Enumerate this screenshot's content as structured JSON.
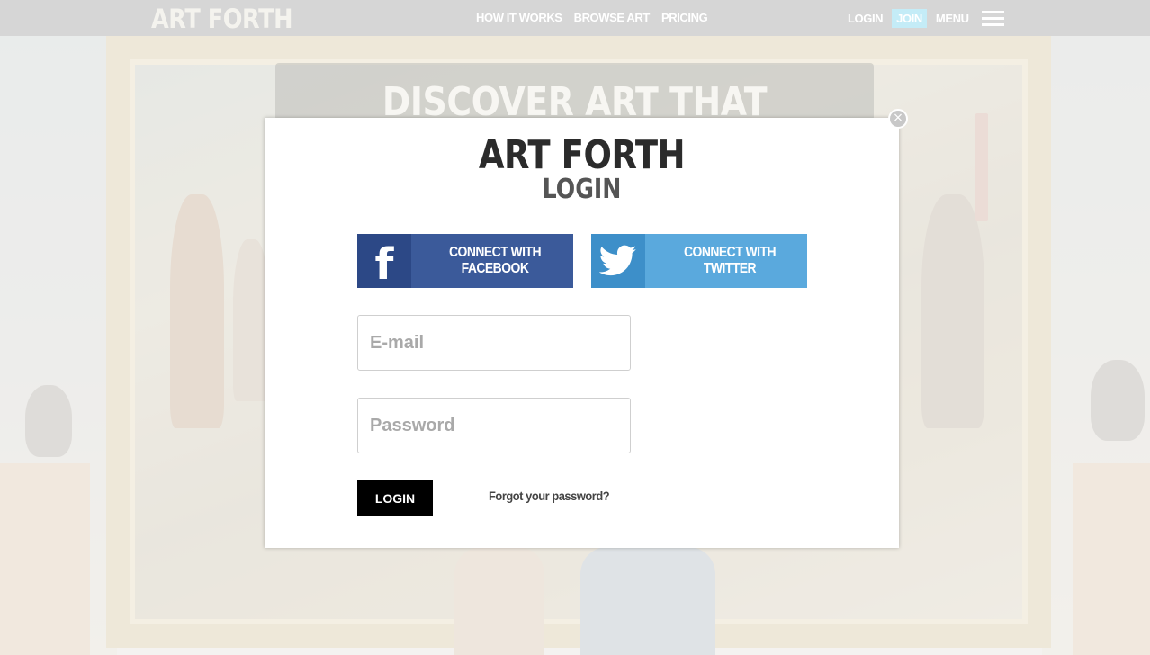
{
  "nav": {
    "logo": "ART FORTH",
    "links": [
      "HOW IT WORKS",
      "BROWSE ART",
      "PRICING"
    ],
    "login": "LOGIN",
    "join": "JOIN",
    "menu": "MENU"
  },
  "hero": {
    "title": "DISCOVER ART THAT MOVES YOU"
  },
  "modal": {
    "close_icon": "close-icon",
    "logo": "ART FORTH",
    "subtitle": "LOGIN",
    "facebook_label": "CONNECT WITH FACEBOOK",
    "facebook_icon": "f",
    "twitter_label": "CONNECT WITH TWITTER",
    "email_placeholder": "E-mail",
    "password_placeholder": "Password",
    "login_button": "LOGIN",
    "forgot_link": "Forgot your password?"
  },
  "colors": {
    "facebook": "#3b5a9a",
    "twitter": "#5aa9dd",
    "join_bg": "#c4ecf7",
    "login_button": "#000000"
  }
}
